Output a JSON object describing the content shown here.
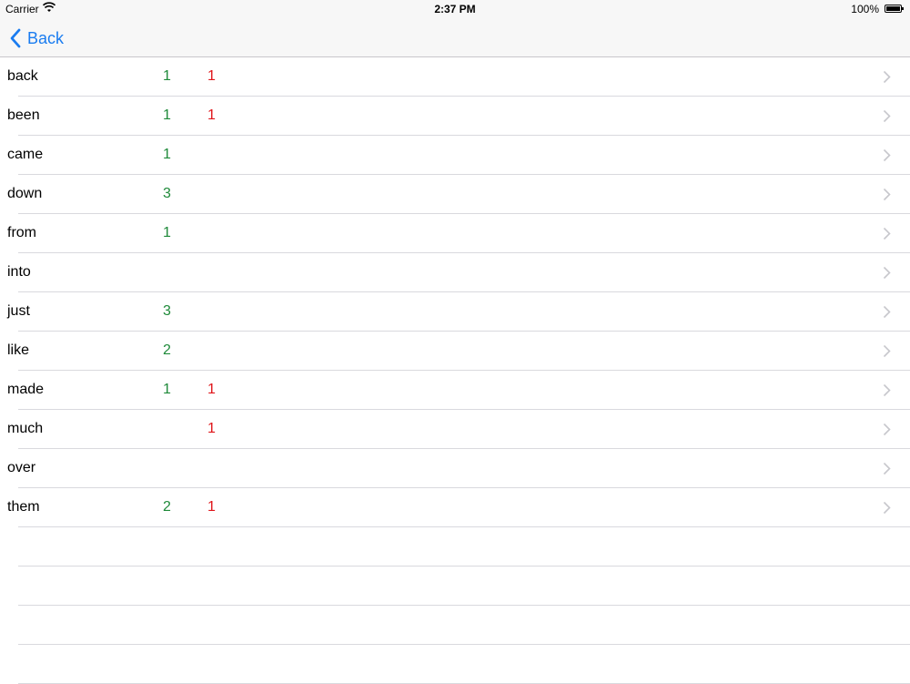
{
  "status_bar": {
    "carrier": "Carrier",
    "time": "2:37 PM",
    "battery": "100%"
  },
  "nav": {
    "back_label": "Back"
  },
  "rows": [
    {
      "word": "back",
      "green": "1",
      "red": "1"
    },
    {
      "word": "been",
      "green": "1",
      "red": "1"
    },
    {
      "word": "came",
      "green": "1",
      "red": ""
    },
    {
      "word": "down",
      "green": "3",
      "red": ""
    },
    {
      "word": "from",
      "green": "1",
      "red": ""
    },
    {
      "word": "into",
      "green": "",
      "red": ""
    },
    {
      "word": "just",
      "green": "3",
      "red": ""
    },
    {
      "word": "like",
      "green": "2",
      "red": ""
    },
    {
      "word": "made",
      "green": "1",
      "red": "1"
    },
    {
      "word": "much",
      "green": "",
      "red": "1"
    },
    {
      "word": "over",
      "green": "",
      "red": ""
    },
    {
      "word": "them",
      "green": "2",
      "red": "1"
    }
  ],
  "colors": {
    "accent": "#1a7cf0",
    "green_count": "#1f8a3a",
    "red_count": "#e0161b"
  },
  "icons": {
    "back": "chevron-left-icon",
    "row": "chevron-right-icon",
    "wifi": "wifi-icon",
    "battery": "battery-icon"
  }
}
